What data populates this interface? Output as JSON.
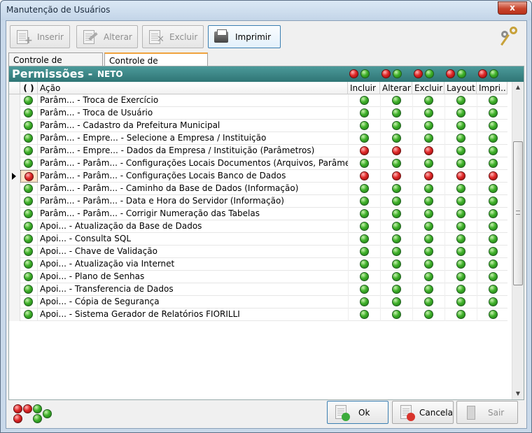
{
  "window": {
    "title": "Manutenção de Usuários",
    "close_label": "x"
  },
  "toolbar": {
    "insert_label": "Inserir",
    "edit_label": "Alterar",
    "delete_label": "Excluir",
    "print_label": "Imprimir",
    "keys_icon": "keys-icon"
  },
  "tabs": [
    {
      "label": "Controle de Usuarios",
      "selected": false
    },
    {
      "label": "Controle de Permissões",
      "selected": true
    }
  ],
  "permissions": {
    "title": "Permissões -",
    "user": "NETO",
    "columns": {
      "toggle": "( )",
      "action": "Ação",
      "incluir": "Incluir",
      "alterar": "Alterar",
      "excluir": "Excluir",
      "layout": "Layout",
      "imprimir": "Impri..."
    },
    "colors": {
      "green": "#3fb12a",
      "red": "#e02828",
      "header_bg": "#3b8585"
    },
    "rows": [
      {
        "name": "Parâm... - Troca de Exercício",
        "status": "green",
        "perms": [
          "green",
          "green",
          "green",
          "green",
          "green"
        ]
      },
      {
        "name": "Parâm... - Troca de Usuário",
        "status": "green",
        "perms": [
          "green",
          "green",
          "green",
          "green",
          "green"
        ]
      },
      {
        "name": "Parâm... - Cadastro da Prefeitura Municipal",
        "status": "green",
        "perms": [
          "green",
          "green",
          "green",
          "green",
          "green"
        ]
      },
      {
        "name": "Parâm... - Empre... - Selecione a Empresa / Instituição",
        "status": "green",
        "perms": [
          "green",
          "green",
          "green",
          "green",
          "green"
        ]
      },
      {
        "name": "Parâm... - Empre... - Dados da Empresa / Instituição (Parâmetros)",
        "status": "green",
        "perms": [
          "red",
          "red",
          "red",
          "green",
          "green"
        ]
      },
      {
        "name": "Parâm... - Parâm... - Configurações Locais Documentos (Arquivos, Parâmet",
        "status": "green",
        "perms": [
          "green",
          "green",
          "green",
          "green",
          "green"
        ]
      },
      {
        "name": "Parâm... - Parâm... - Configurações Locais Banco de Dados",
        "status": "red",
        "perms": [
          "red",
          "red",
          "red",
          "red",
          "red"
        ],
        "current": true
      },
      {
        "name": "Parâm... - Parâm... - Caminho da Base de Dados (Informação)",
        "status": "green",
        "perms": [
          "green",
          "green",
          "green",
          "green",
          "green"
        ]
      },
      {
        "name": "Parâm... - Parâm... - Data e Hora do Servidor (Informação)",
        "status": "green",
        "perms": [
          "green",
          "green",
          "green",
          "green",
          "green"
        ]
      },
      {
        "name": "Parâm... - Parâm... - Corrigir Numeração das Tabelas",
        "status": "green",
        "perms": [
          "green",
          "green",
          "green",
          "green",
          "green"
        ]
      },
      {
        "name": "Apoi... - Atualização da  Base de Dados",
        "status": "green",
        "perms": [
          "green",
          "green",
          "green",
          "green",
          "green"
        ]
      },
      {
        "name": "Apoi... - Consulta SQL",
        "status": "green",
        "perms": [
          "green",
          "green",
          "green",
          "green",
          "green"
        ]
      },
      {
        "name": "Apoi... - Chave de Validação",
        "status": "green",
        "perms": [
          "green",
          "green",
          "green",
          "green",
          "green"
        ]
      },
      {
        "name": "Apoi... - Atualização via Internet",
        "status": "green",
        "perms": [
          "green",
          "green",
          "green",
          "green",
          "green"
        ]
      },
      {
        "name": "Apoi... - Plano de Senhas",
        "status": "green",
        "perms": [
          "green",
          "green",
          "green",
          "green",
          "green"
        ]
      },
      {
        "name": "Apoi... - Transferencia de Dados",
        "status": "green",
        "perms": [
          "green",
          "green",
          "green",
          "green",
          "green"
        ]
      },
      {
        "name": "Apoi... - Cópia de Segurança",
        "status": "green",
        "perms": [
          "green",
          "green",
          "green",
          "green",
          "green"
        ]
      },
      {
        "name": "Apoi... - Sistema Gerador de Relatórios FIORILLI",
        "status": "green",
        "perms": [
          "green",
          "green",
          "green",
          "green",
          "green"
        ]
      }
    ]
  },
  "footer": {
    "ok_label": "Ok",
    "cancel_label": "Cancela",
    "exit_label": "Sair"
  }
}
